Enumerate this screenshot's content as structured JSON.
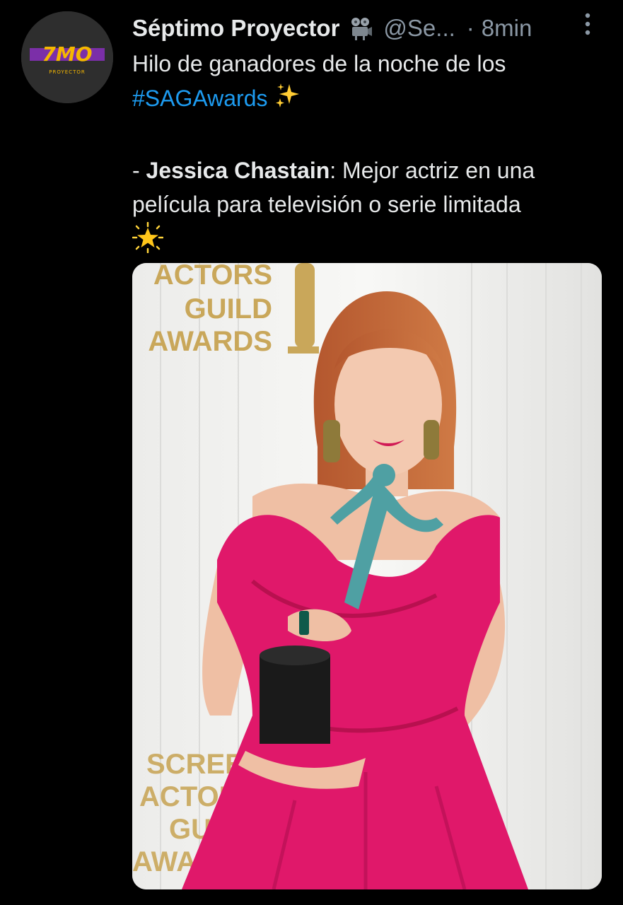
{
  "tweet": {
    "author_name": "Séptimo Proyector",
    "handle": "@Se...",
    "time_sep": "·",
    "time": "8min",
    "avatar_text": "7MO",
    "avatar_subtext": "PROYECTOR",
    "intro": "Hilo de ganadores de la noche de los",
    "hashtag": "#SAGAwards",
    "winner_prefix": "- ",
    "winner_name": "Jessica Chastain",
    "winner_colon": ":",
    "category_line1": " Mejor actriz en una",
    "category_line2": "película para televisión o serie limitada"
  },
  "media": {
    "backdrop_top_lines": [
      "ACTORS",
      "GUILD",
      "AWARDS"
    ],
    "backdrop_bottom_lines": [
      "SCREEN",
      "ACTORS",
      "GUILD",
      "AWARDS"
    ]
  },
  "icons": {
    "camera": "film-projector-icon",
    "more": "more-vertical-icon",
    "sparkles": "sparkles-icon",
    "star": "glowing-star-icon"
  },
  "colors": {
    "background": "#000000",
    "text": "#e7e9ea",
    "muted": "#8b98a5",
    "link": "#1d9bf0",
    "dress": "#e0186a",
    "statuette": "#4fa0a3",
    "gold": "#c9a75a"
  }
}
